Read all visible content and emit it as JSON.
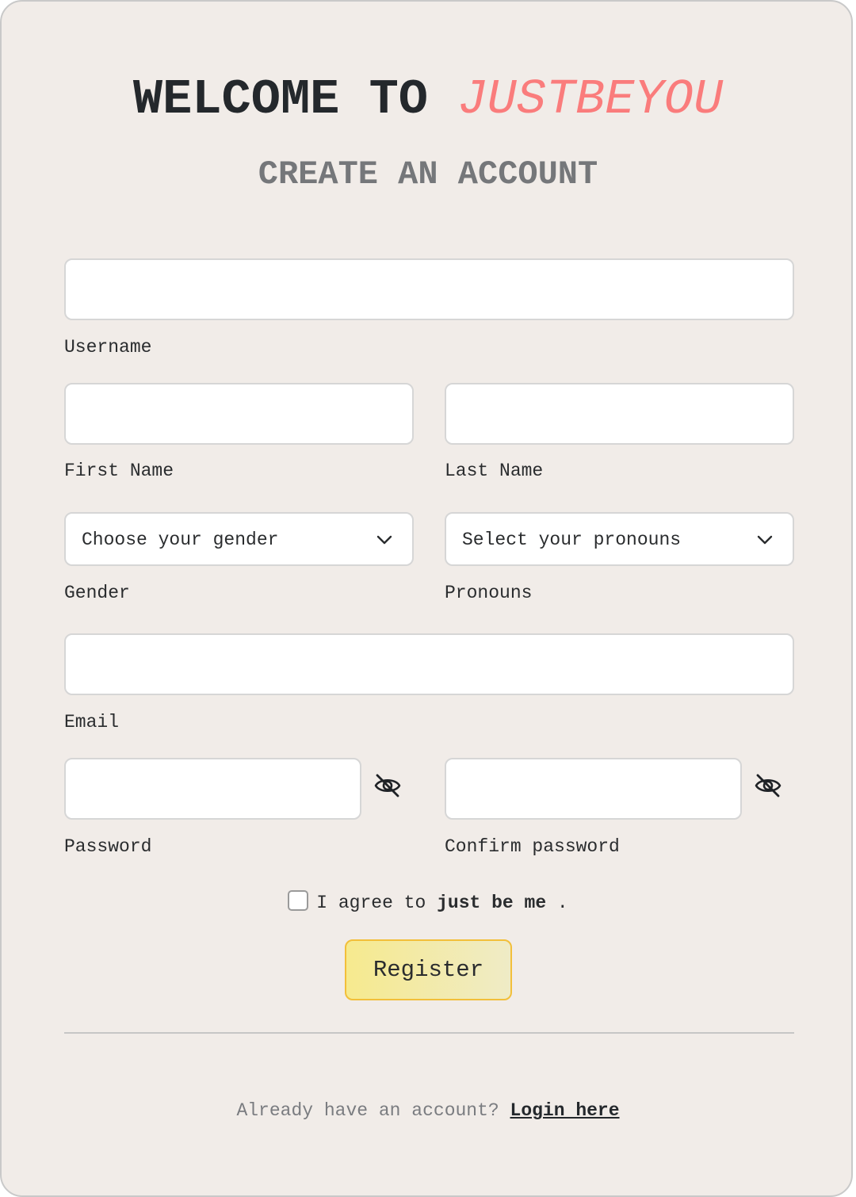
{
  "header": {
    "title_prefix": "WELCOME TO ",
    "title_brand": "JUSTBEYOU",
    "subtitle": "CREATE AN ACCOUNT"
  },
  "form": {
    "username": {
      "label": "Username",
      "value": ""
    },
    "first_name": {
      "label": "First Name",
      "value": ""
    },
    "last_name": {
      "label": "Last Name",
      "value": ""
    },
    "gender": {
      "label": "Gender",
      "selected": "Choose your gender",
      "icon": "chevron-down-icon"
    },
    "pronouns": {
      "label": "Pronouns",
      "selected": "Select your pronouns",
      "icon": "chevron-down-icon"
    },
    "email": {
      "label": "Email",
      "value": ""
    },
    "password": {
      "label": "Password",
      "value": "",
      "icon": "eye-slash-icon"
    },
    "confirm_password": {
      "label": "Confirm password",
      "value": "",
      "icon": "eye-slash-icon"
    },
    "agree": {
      "prefix": "I agree to ",
      "emphasis": "just be me",
      "suffix": " .",
      "checked": false
    },
    "register_label": "Register"
  },
  "footer": {
    "prompt": "Already have an account? ",
    "login_label": "Login here"
  },
  "colors": {
    "brand": "#fa7c7c",
    "background": "#f1ece8",
    "button_border": "#f2bf3a"
  }
}
